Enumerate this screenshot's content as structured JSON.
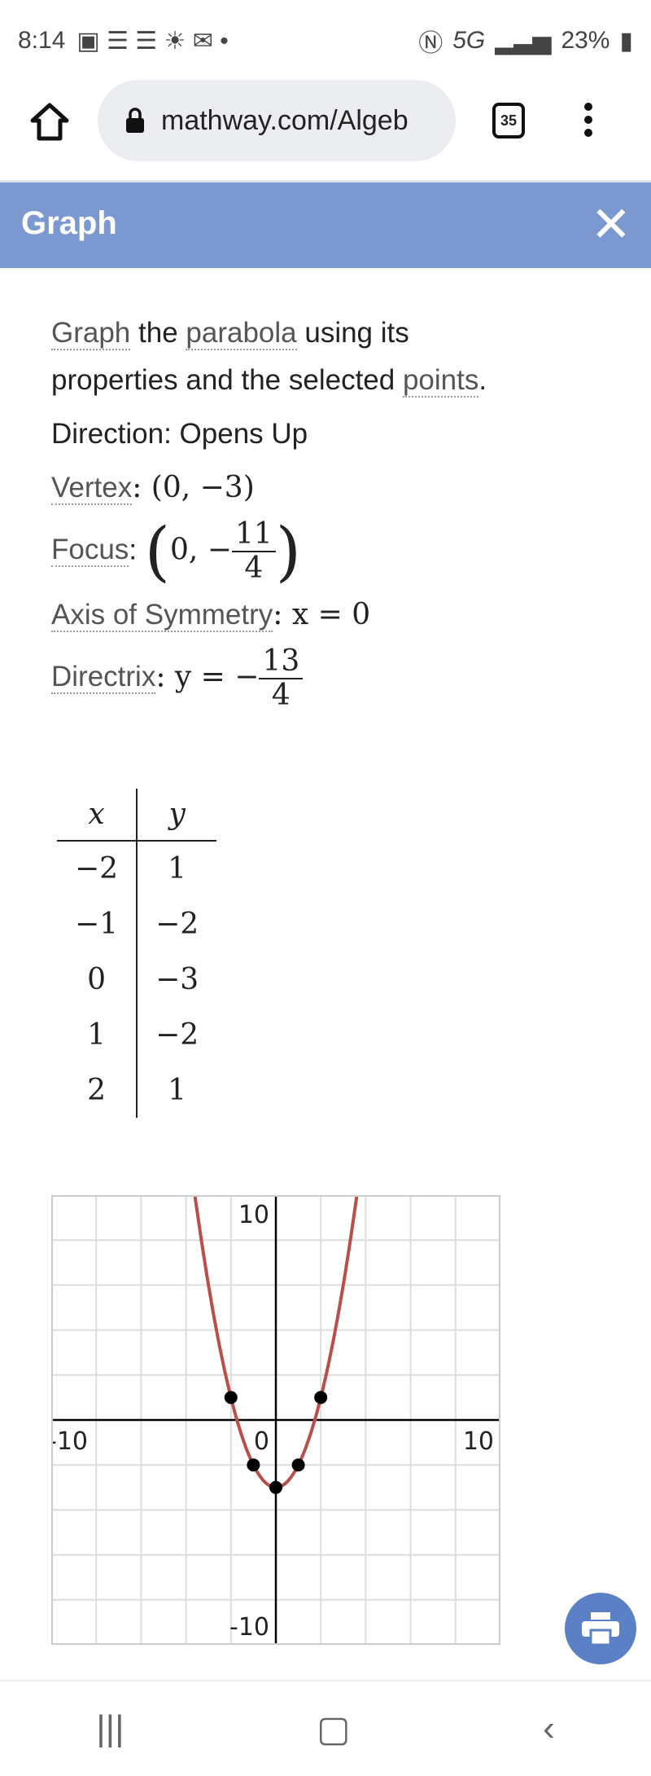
{
  "status": {
    "time": "8:14",
    "network": "5G",
    "battery": "23%"
  },
  "browser": {
    "url": "mathway.com/Algeb",
    "tab_count": "35"
  },
  "header": {
    "title": "Graph",
    "close": "✕"
  },
  "content": {
    "intro": {
      "w1": "Graph",
      "w2": " the ",
      "w3": "parabola",
      "w4": " using its",
      "w5": "properties and the selected ",
      "w6": "points",
      "w7": "."
    },
    "direction": "Direction: Opens Up",
    "vertex": {
      "label": "Vertex",
      "value": ": (0, −3)"
    },
    "focus": {
      "label": "Focus",
      "pre": "0, −",
      "num": "11",
      "den": "4"
    },
    "axis": {
      "label": "Axis of Symmetry",
      "value": ": x = 0"
    },
    "directrix": {
      "label": "Directrix",
      "pre": ": y = −",
      "num": "13",
      "den": "4"
    }
  },
  "table": {
    "headers": [
      "x",
      "y"
    ],
    "rows": [
      [
        "−2",
        "1"
      ],
      [
        "−1",
        "−2"
      ],
      [
        "0",
        "−3"
      ],
      [
        "1",
        "−2"
      ],
      [
        "2",
        "1"
      ]
    ]
  },
  "chart_data": {
    "type": "line",
    "function": "y = x^2 - 3",
    "xlim": [
      -10,
      10
    ],
    "ylim": [
      -10,
      10
    ],
    "grid": true,
    "grid_step": 2,
    "tick_labels": {
      "x": [
        "-10",
        "0",
        "10"
      ],
      "y": [
        "10",
        "-10"
      ]
    },
    "curve_color": "#b94e4a",
    "points": [
      {
        "x": -2,
        "y": 1
      },
      {
        "x": -1,
        "y": -2
      },
      {
        "x": 0,
        "y": -3
      },
      {
        "x": 1,
        "y": -2
      },
      {
        "x": 2,
        "y": 1
      }
    ]
  },
  "icons": {
    "print": "print-icon"
  }
}
